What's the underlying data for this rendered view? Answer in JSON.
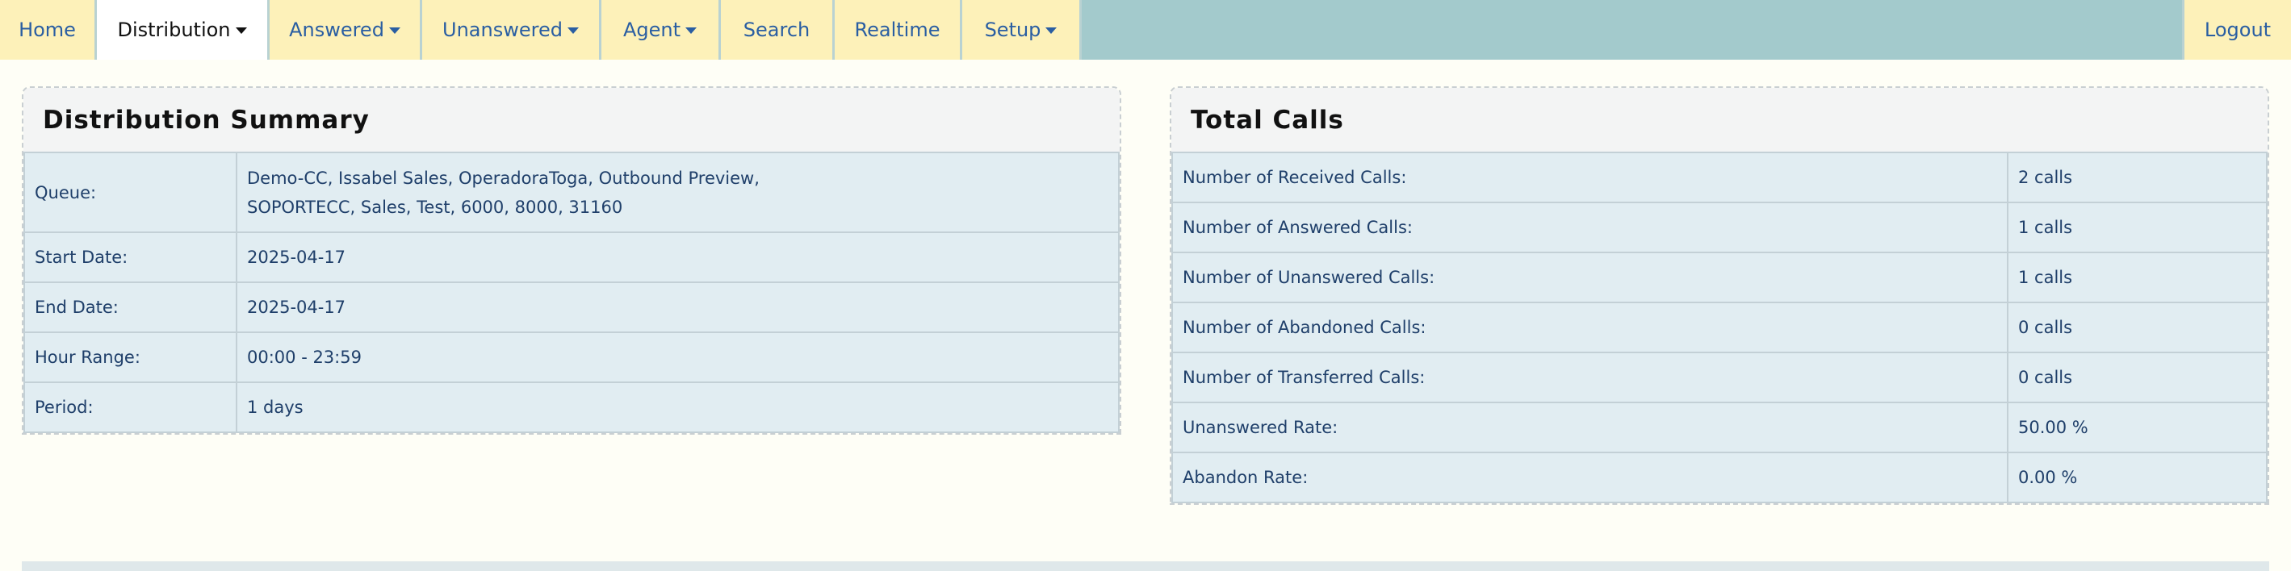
{
  "nav": {
    "tabs": [
      {
        "label": "Home",
        "dropdown": false,
        "active": false
      },
      {
        "label": "Distribution",
        "dropdown": true,
        "active": true
      },
      {
        "label": "Answered",
        "dropdown": true,
        "active": false
      },
      {
        "label": "Unanswered",
        "dropdown": true,
        "active": false
      },
      {
        "label": "Agent",
        "dropdown": true,
        "active": false
      },
      {
        "label": "Search",
        "dropdown": false,
        "active": false
      },
      {
        "label": "Realtime",
        "dropdown": false,
        "active": false
      },
      {
        "label": "Setup",
        "dropdown": true,
        "active": false
      }
    ],
    "logout": "Logout"
  },
  "summary": {
    "title": "Distribution Summary",
    "rows": [
      {
        "label": "Queue:",
        "value_line1": "Demo-CC, Issabel Sales, OperadoraToga, Outbound Preview,",
        "value_line2": "SOPORTECC, Sales, Test, 6000, 8000, 31160"
      },
      {
        "label": "Start Date:",
        "value": "2025-04-17"
      },
      {
        "label": "End Date:",
        "value": "2025-04-17"
      },
      {
        "label": "Hour Range:",
        "value": "00:00 - 23:59"
      },
      {
        "label": "Period:",
        "value": "1 days"
      }
    ]
  },
  "totals": {
    "title": "Total Calls",
    "rows": [
      {
        "label": "Number of Received Calls:",
        "value": "2 calls"
      },
      {
        "label": "Number of Answered Calls:",
        "value": "1 calls"
      },
      {
        "label": "Number of Unanswered Calls:",
        "value": "1 calls"
      },
      {
        "label": "Number of Abandoned Calls:",
        "value": "0 calls"
      },
      {
        "label": "Number of Transferred Calls:",
        "value": "0 calls"
      },
      {
        "label": "Unanswered Rate:",
        "value": "50.00 %"
      },
      {
        "label": "Abandon Rate:",
        "value": "0.00 %"
      }
    ]
  },
  "colors": {
    "nav_bar": "#a3cacc",
    "tab": "#fdf1b9",
    "tab_active": "#ffffff",
    "link": "#2a5ea2",
    "table_bg": "#e1edf2",
    "page_bg": "#fefef6"
  }
}
